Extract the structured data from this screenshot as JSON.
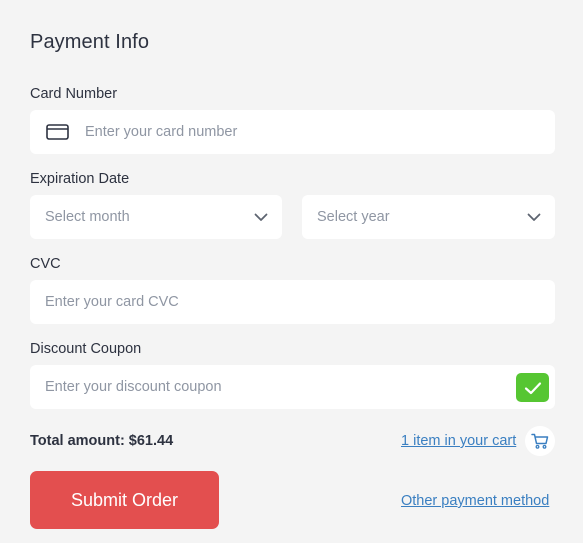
{
  "colors": {
    "background": "#f4f4f4",
    "field": "#ffffff",
    "accent_link": "#3a7fc1",
    "submit": "#e34f4f",
    "check": "#56c632",
    "text": "#2d3240",
    "placeholder": "#8f96a3"
  },
  "form": {
    "title": "Payment Info",
    "card_number": {
      "label": "Card Number",
      "placeholder": "Enter your card number",
      "icon": "credit-card-icon"
    },
    "expiration": {
      "label": "Expiration Date",
      "month_placeholder": "Select month",
      "year_placeholder": "Select year",
      "icon": "chevron-down-icon"
    },
    "cvc": {
      "label": "CVC",
      "placeholder": "Enter your card CVC"
    },
    "coupon": {
      "label": "Discount Coupon",
      "placeholder": "Enter your discount coupon",
      "icon": "check-icon"
    }
  },
  "summary": {
    "total_label": "Total amount: $61.44",
    "cart_link": "1 item in your cart",
    "cart_icon": "cart-icon"
  },
  "actions": {
    "submit_label": "Submit Order",
    "other_method": "Other payment method"
  }
}
